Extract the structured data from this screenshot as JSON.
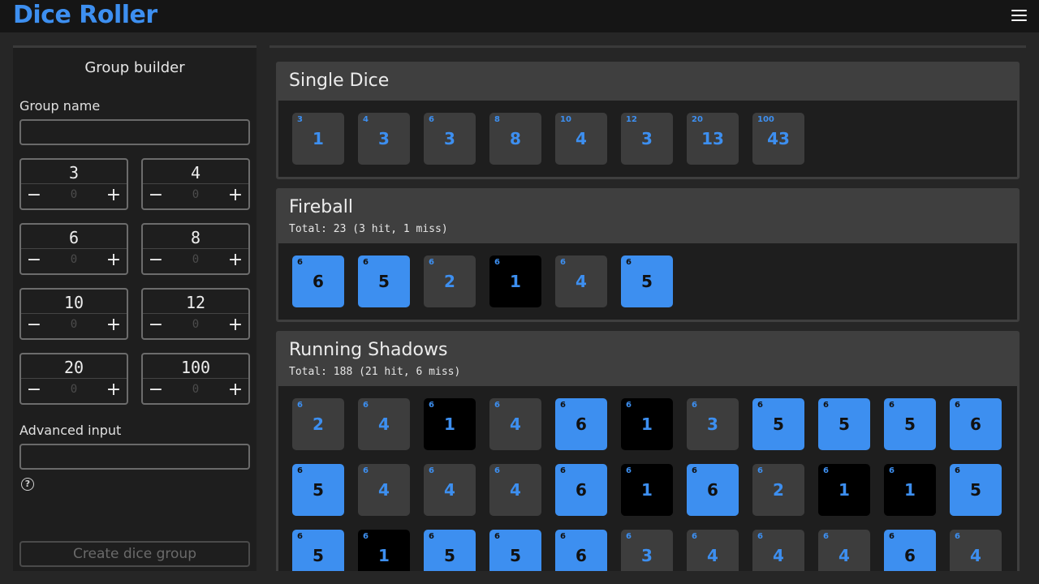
{
  "app": {
    "title": "Dice Roller",
    "menu_icon": "hamburger-menu-icon"
  },
  "colors": {
    "accent": "#3d8ff0",
    "die_normal": "#3d3d3d",
    "die_hit": "#3d8ff0",
    "die_miss": "#000000"
  },
  "sidebar": {
    "title": "Group builder",
    "group_name_label": "Group name",
    "group_name_value": "",
    "dice": [
      {
        "sides": "3",
        "count": "0"
      },
      {
        "sides": "4",
        "count": "0"
      },
      {
        "sides": "6",
        "count": "0"
      },
      {
        "sides": "8",
        "count": "0"
      },
      {
        "sides": "10",
        "count": "0"
      },
      {
        "sides": "12",
        "count": "0"
      },
      {
        "sides": "20",
        "count": "0"
      },
      {
        "sides": "100",
        "count": "0"
      }
    ],
    "minus_label": "−",
    "plus_label": "+",
    "advanced_label": "Advanced input",
    "advanced_value": "",
    "help_label": "?",
    "create_button": "Create dice group"
  },
  "groups": [
    {
      "title": "Single Dice",
      "total": "",
      "dice": [
        {
          "sides": "3",
          "value": "1",
          "state": "normal"
        },
        {
          "sides": "4",
          "value": "3",
          "state": "normal"
        },
        {
          "sides": "6",
          "value": "3",
          "state": "normal"
        },
        {
          "sides": "8",
          "value": "8",
          "state": "normal"
        },
        {
          "sides": "10",
          "value": "4",
          "state": "normal"
        },
        {
          "sides": "12",
          "value": "3",
          "state": "normal"
        },
        {
          "sides": "20",
          "value": "13",
          "state": "normal"
        },
        {
          "sides": "100",
          "value": "43",
          "state": "normal"
        }
      ]
    },
    {
      "title": "Fireball",
      "total": "Total: 23 (3 hit, 1 miss)",
      "dice": [
        {
          "sides": "6",
          "value": "6",
          "state": "hit"
        },
        {
          "sides": "6",
          "value": "5",
          "state": "hit"
        },
        {
          "sides": "6",
          "value": "2",
          "state": "normal"
        },
        {
          "sides": "6",
          "value": "1",
          "state": "miss"
        },
        {
          "sides": "6",
          "value": "4",
          "state": "normal"
        },
        {
          "sides": "6",
          "value": "5",
          "state": "hit"
        }
      ]
    },
    {
      "title": "Running Shadows",
      "total": "Total: 188 (21 hit, 6 miss)",
      "dice": [
        {
          "sides": "6",
          "value": "2",
          "state": "normal"
        },
        {
          "sides": "6",
          "value": "4",
          "state": "normal"
        },
        {
          "sides": "6",
          "value": "1",
          "state": "miss"
        },
        {
          "sides": "6",
          "value": "4",
          "state": "normal"
        },
        {
          "sides": "6",
          "value": "6",
          "state": "hit"
        },
        {
          "sides": "6",
          "value": "1",
          "state": "miss"
        },
        {
          "sides": "6",
          "value": "3",
          "state": "normal"
        },
        {
          "sides": "6",
          "value": "5",
          "state": "hit"
        },
        {
          "sides": "6",
          "value": "5",
          "state": "hit"
        },
        {
          "sides": "6",
          "value": "5",
          "state": "hit"
        },
        {
          "sides": "6",
          "value": "6",
          "state": "hit"
        },
        {
          "sides": "6",
          "value": "5",
          "state": "hit"
        },
        {
          "sides": "6",
          "value": "4",
          "state": "normal"
        },
        {
          "sides": "6",
          "value": "4",
          "state": "normal"
        },
        {
          "sides": "6",
          "value": "4",
          "state": "normal"
        },
        {
          "sides": "6",
          "value": "6",
          "state": "hit"
        },
        {
          "sides": "6",
          "value": "1",
          "state": "miss"
        },
        {
          "sides": "6",
          "value": "6",
          "state": "hit"
        },
        {
          "sides": "6",
          "value": "2",
          "state": "normal"
        },
        {
          "sides": "6",
          "value": "1",
          "state": "miss"
        },
        {
          "sides": "6",
          "value": "1",
          "state": "miss"
        },
        {
          "sides": "6",
          "value": "5",
          "state": "hit"
        },
        {
          "sides": "6",
          "value": "5",
          "state": "hit"
        },
        {
          "sides": "6",
          "value": "1",
          "state": "miss"
        },
        {
          "sides": "6",
          "value": "5",
          "state": "hit"
        },
        {
          "sides": "6",
          "value": "5",
          "state": "hit"
        },
        {
          "sides": "6",
          "value": "6",
          "state": "hit"
        },
        {
          "sides": "6",
          "value": "3",
          "state": "normal"
        },
        {
          "sides": "6",
          "value": "4",
          "state": "normal"
        },
        {
          "sides": "6",
          "value": "4",
          "state": "normal"
        },
        {
          "sides": "6",
          "value": "4",
          "state": "normal"
        },
        {
          "sides": "6",
          "value": "6",
          "state": "hit"
        },
        {
          "sides": "6",
          "value": "4",
          "state": "normal"
        }
      ]
    }
  ]
}
